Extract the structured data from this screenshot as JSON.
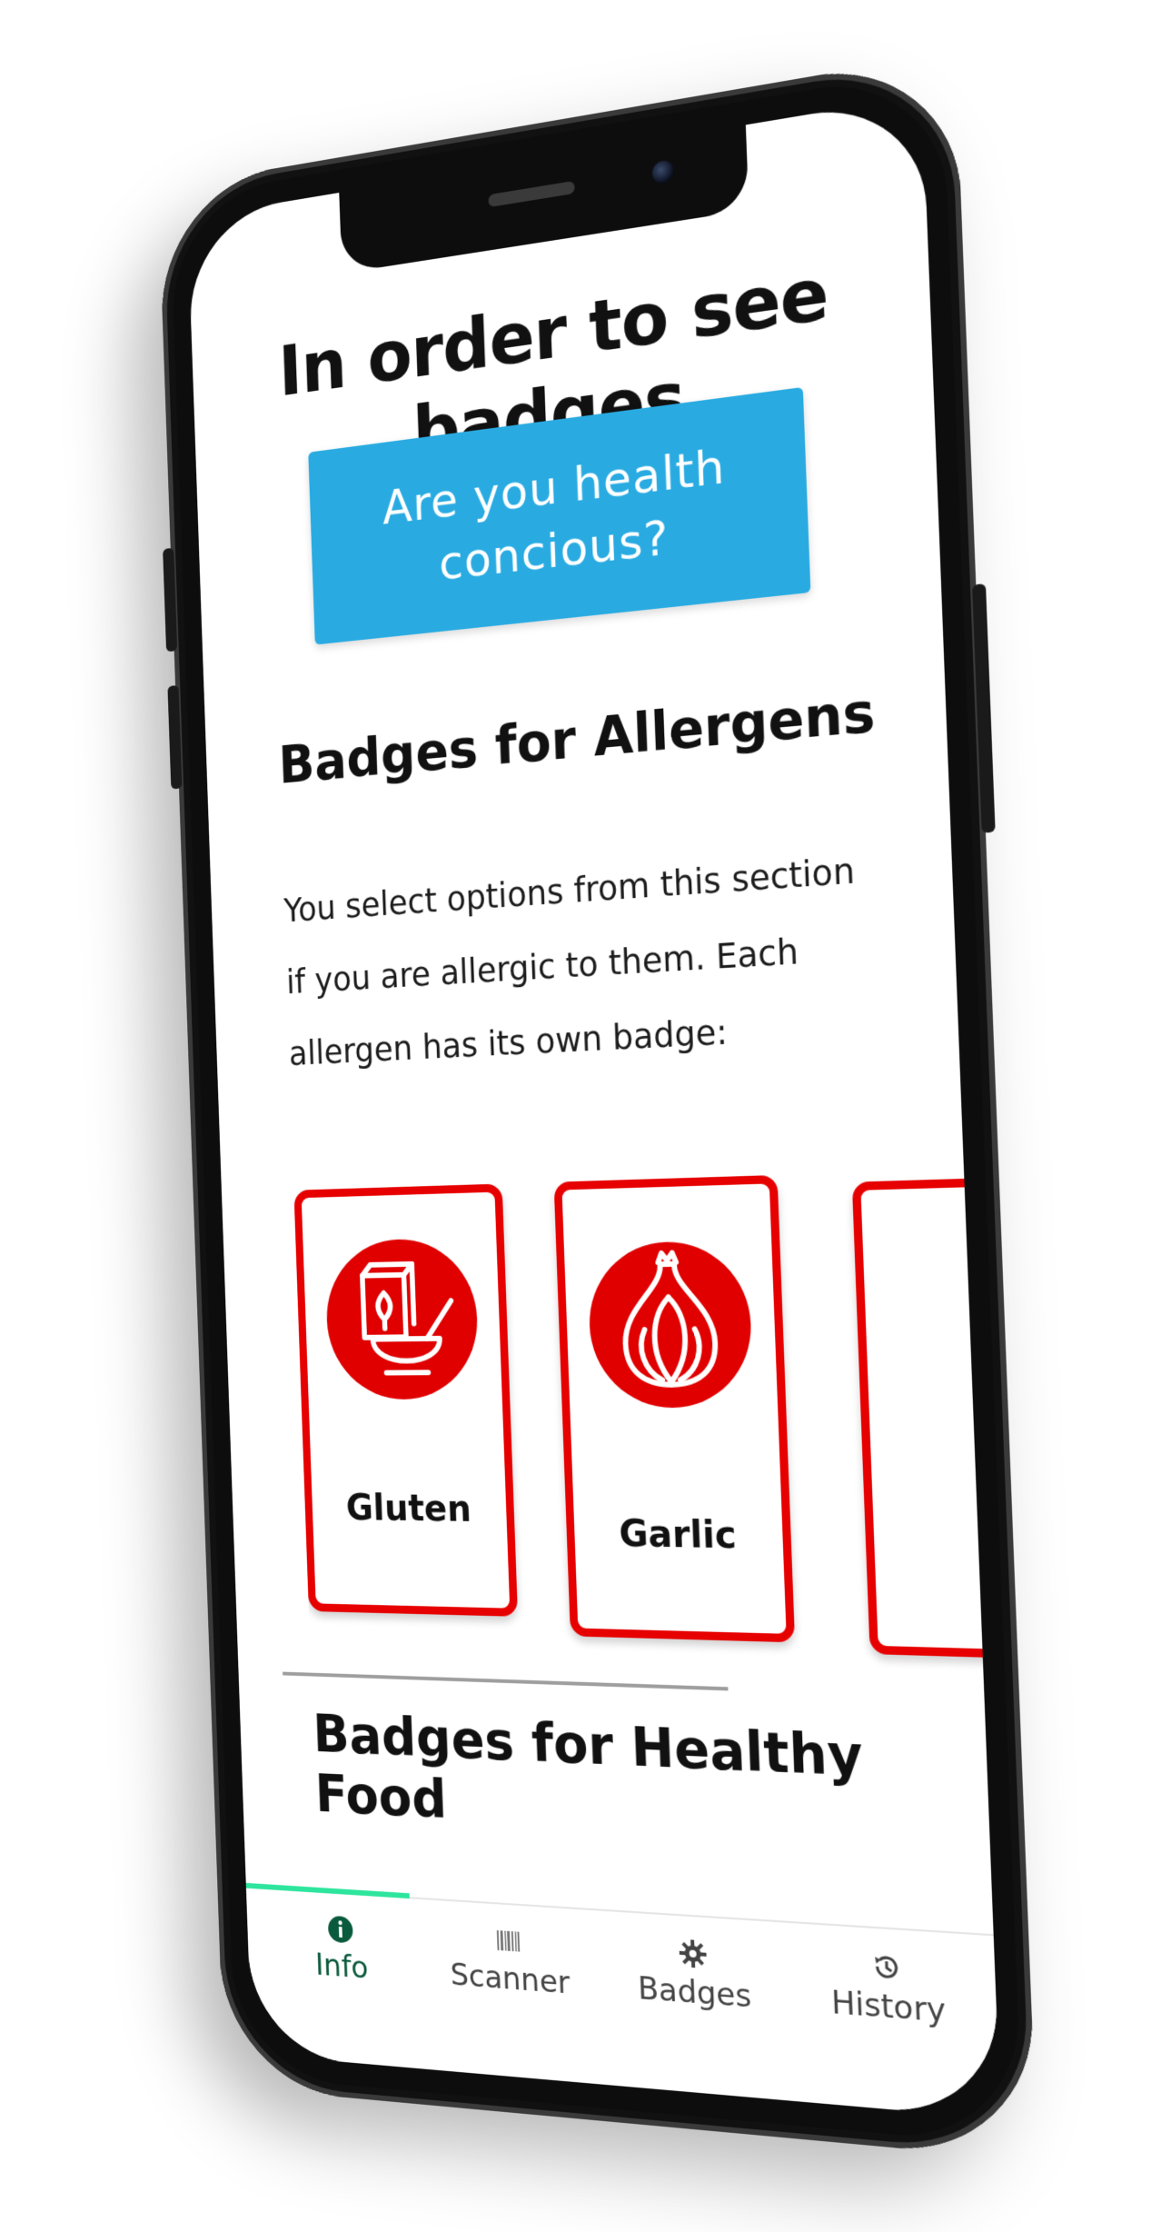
{
  "page": {
    "title": "In order to see badges",
    "cta_label": "Are you health concious?"
  },
  "allergens": {
    "heading": "Badges for Allergens",
    "description": "You select options from this section if you are allergic to them. Each allergen has its own badge:",
    "items": [
      {
        "label": "Gluten",
        "icon": "cereal-bowl-icon"
      },
      {
        "label": "Garlic",
        "icon": "garlic-icon"
      },
      {
        "label": "",
        "icon": "partial-badge"
      }
    ]
  },
  "healthy": {
    "heading": "Badges for Healthy Food"
  },
  "tabs": [
    {
      "label": "Info",
      "icon": "info-icon",
      "active": true
    },
    {
      "label": "Scanner",
      "icon": "barcode-icon",
      "active": false
    },
    {
      "label": "Badges",
      "icon": "gear-icon",
      "active": false
    },
    {
      "label": "History",
      "icon": "history-icon",
      "active": false
    }
  ],
  "colors": {
    "accent": "#29abe2",
    "badge_red": "#e60000",
    "active_tab": "#0a5a3c",
    "tab_indicator": "#2ee59d"
  }
}
